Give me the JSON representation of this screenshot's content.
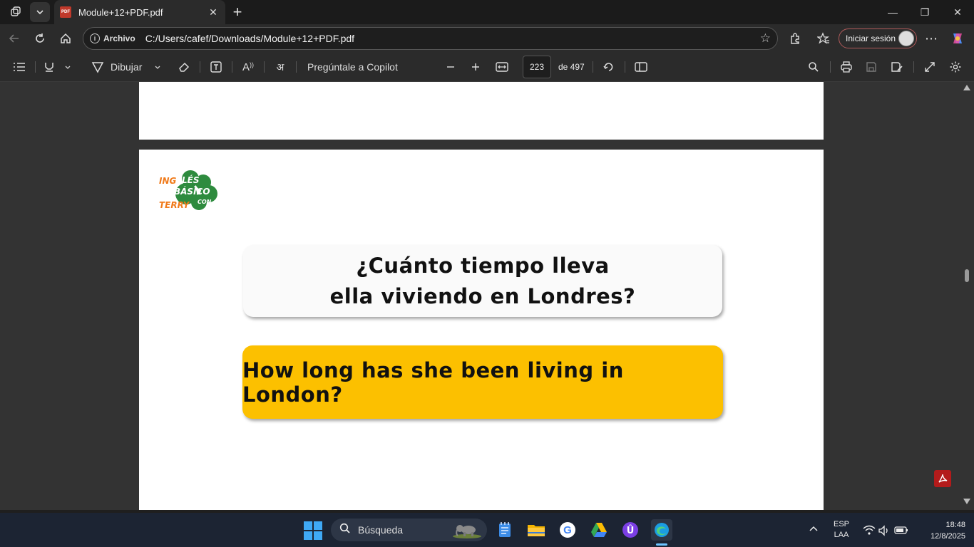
{
  "tab": {
    "title": "Module+12+PDF.pdf",
    "favicon_text": "PDF",
    "close_glyph": "✕"
  },
  "window_controls": {
    "minimize": "—",
    "restore": "❐",
    "close": "✕"
  },
  "address": {
    "archivo_label": "Archivo",
    "url": "C:/Users/cafef/Downloads/Module+12+PDF.pdf",
    "signin_label": "Iniciar sesión"
  },
  "pdf_toolbar": {
    "draw_label": "Dibujar",
    "copilot_label": "Pregúntale a Copilot",
    "current_page": "223",
    "total_pages": "de 497"
  },
  "document": {
    "logo_texts": {
      "ing": "ING",
      "les": "LÉS",
      "basico": "BÁSICO",
      "con": "CON",
      "terry": "TERRY"
    },
    "spanish_line1": "¿Cuánto tiempo lleva",
    "spanish_line2": "ella viviendo en Londres?",
    "english_question": "How long has she been living in London?"
  },
  "taskbar": {
    "search_label": "Búsqueda",
    "lang_top": "ESP",
    "lang_bottom": "LAA",
    "time": "18:48",
    "date": "12/8/2025"
  },
  "colors": {
    "accent_yellow": "#fcc000",
    "logo_green": "#2e8b3e",
    "logo_orange": "#f07a1a",
    "taskbar_bg": "#1c2433"
  }
}
